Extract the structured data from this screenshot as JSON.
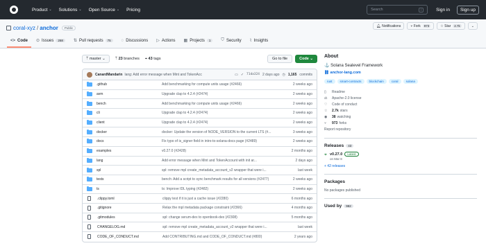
{
  "header": {
    "nav": [
      "Product",
      "Solutions",
      "Open Source",
      "Pricing"
    ],
    "search_placeholder": "Search",
    "search_shortcut": "/",
    "sign_in": "Sign in",
    "sign_up": "Sign up"
  },
  "repo": {
    "owner": "coral-xyz",
    "name": "anchor",
    "visibility": "Public",
    "actions": [
      {
        "label": "Notifications",
        "count": ""
      },
      {
        "label": "Fork",
        "count": "973"
      },
      {
        "label": "Star",
        "count": "2.7k"
      }
    ],
    "tabs": [
      {
        "label": "Code",
        "count": ""
      },
      {
        "label": "Issues",
        "count": "268"
      },
      {
        "label": "Pull requests",
        "count": "75"
      },
      {
        "label": "Discussions",
        "count": ""
      },
      {
        "label": "Actions",
        "count": ""
      },
      {
        "label": "Projects",
        "count": "1"
      },
      {
        "label": "Security",
        "count": ""
      },
      {
        "label": "Insights",
        "count": ""
      }
    ]
  },
  "toolbar": {
    "branch": "master",
    "branches_count": "23",
    "branches_label": "branches",
    "tags_count": "43",
    "tags_label": "tags",
    "go_to_file": "Go to file",
    "code": "Code"
  },
  "commit": {
    "author": "CanardMandarin",
    "message": "lang: Add error message when Mint and TokenAccount with ...",
    "hash": "71da324",
    "time": "2 days ago",
    "commits_count": "1,165",
    "commits_label": "commits"
  },
  "files": [
    {
      "type": "dir",
      "name": ".github",
      "message": "Add benchmarking for compute units usage (#2466)",
      "date": "2 weeks ago"
    },
    {
      "type": "dir",
      "name": "avm",
      "message": "Upgrade clap to 4.2.4 (#2474)",
      "date": "2 weeks ago"
    },
    {
      "type": "dir",
      "name": "bench",
      "message": "Add benchmarking for compute units usage (#2466)",
      "date": "2 weeks ago"
    },
    {
      "type": "dir",
      "name": "cli",
      "message": "Upgrade clap to 4.2.4 (#2474)",
      "date": "2 weeks ago"
    },
    {
      "type": "dir",
      "name": "client",
      "message": "Upgrade clap to 4.2.4 (#2474)",
      "date": "2 weeks ago"
    },
    {
      "type": "dir",
      "name": "docker",
      "message": "docker: Update the version of NODE_VERSION to the current LTS (#...",
      "date": "3 weeks ago"
    },
    {
      "type": "dir",
      "name": "docs",
      "message": "Fix typo of is_signer field in intro-to-solana-docs page (#2489)",
      "date": "2 weeks ago"
    },
    {
      "type": "dir",
      "name": "examples",
      "message": "v0.27.0 (#2428)",
      "date": "2 months ago"
    },
    {
      "type": "dir",
      "name": "lang",
      "message": "Add error message when Mint and TokenAccount with init ar...",
      "date": "2 days ago"
    },
    {
      "type": "dir",
      "name": "spl",
      "message": "spl: remove mpl create_metadata_account_v2 wrapper that were i...",
      "date": "last week"
    },
    {
      "type": "dir",
      "name": "tests",
      "message": "bench: Add a script to sync benchmark results for all versions (#2477)",
      "date": "2 weeks ago"
    },
    {
      "type": "dir",
      "name": "ts",
      "message": "ts: Improve IDL typing (#2482)",
      "date": "2 weeks ago"
    },
    {
      "type": "file",
      "name": ".clippy.toml",
      "message": "clippy test if it is just a cache issue (#2280)",
      "date": "6 months ago"
    },
    {
      "type": "file",
      "name": ".gitignore",
      "message": "Relax the mpl metadata package constraint (#2366)",
      "date": "4 months ago"
    },
    {
      "type": "file",
      "name": ".gitmodules",
      "message": "spl: change serum-dex to openbook-dex (#2308)",
      "date": "5 months ago"
    },
    {
      "type": "file",
      "name": "CHANGELOG.md",
      "message": "spl: remove mpl create_metadata_account_v2 wrapper that were i...",
      "date": "last week"
    },
    {
      "type": "file",
      "name": "CODE_OF_CONDUCT.md",
      "message": "Add CONTRIBUTING.md and CODE_OF_CONDUCT.md (#800)",
      "date": "2 years ago"
    }
  ],
  "sidebar": {
    "about_title": "About",
    "description": "Solana Sealevel Framework",
    "website": "anchor-lang.com",
    "topics": [
      "rust",
      "smart-contracts",
      "blockchain",
      "coral",
      "solana"
    ],
    "stats": [
      {
        "icon": "book-icon",
        "value": "",
        "label": "Readme"
      },
      {
        "icon": "law-icon",
        "value": "",
        "label": "Apache-2.0 license"
      },
      {
        "icon": "heart-icon",
        "value": "",
        "label": "Code of conduct"
      },
      {
        "icon": "star-icon",
        "value": "2.7k",
        "label": "stars"
      },
      {
        "icon": "eye-icon",
        "value": "38",
        "label": "watching"
      },
      {
        "icon": "fork-icon",
        "value": "973",
        "label": "forks"
      }
    ],
    "report": "Report repository",
    "releases_title": "Releases",
    "releases_count": "43",
    "release_version": "v0.27.0",
    "release_badge": "Latest",
    "release_date": "on Mar 8",
    "more_releases": "+ 42 releases",
    "packages_title": "Packages",
    "packages_empty": "No packages published",
    "used_by_title": "Used by",
    "used_by_count": "982"
  }
}
